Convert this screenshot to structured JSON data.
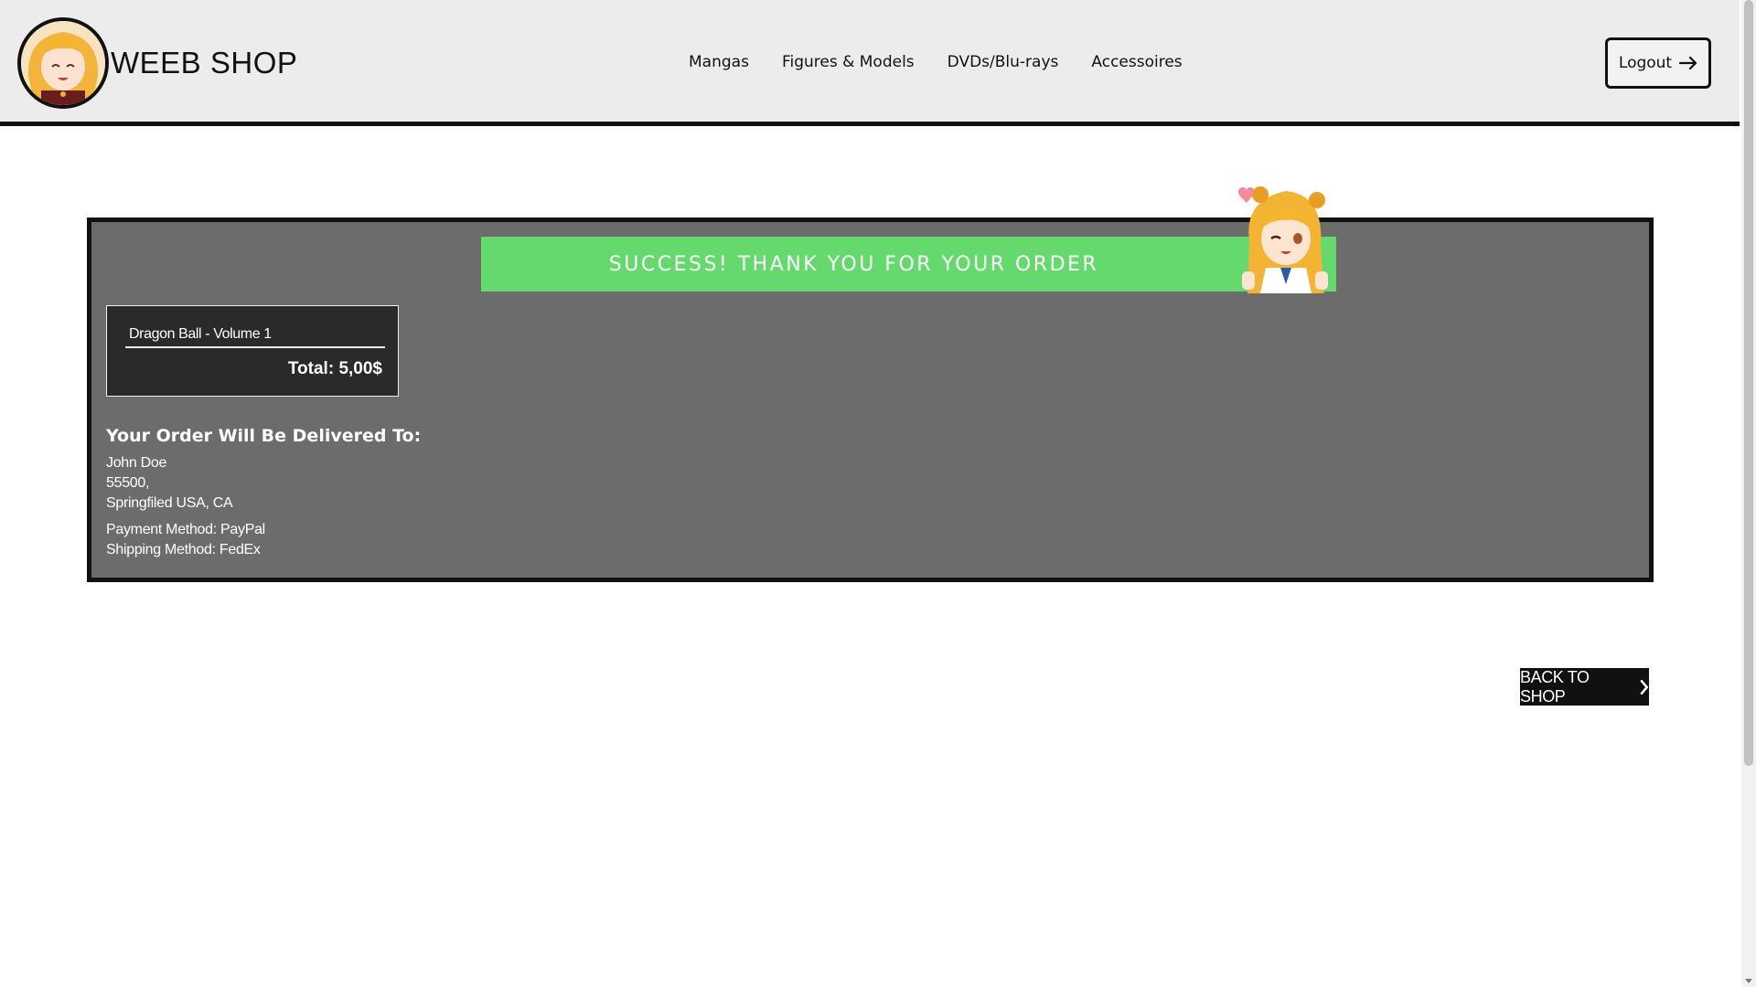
{
  "header": {
    "brand": "WEEB SHOP",
    "nav": [
      "Mangas",
      "Figures & Models",
      "DVDs/Blu-rays",
      "Accessoires"
    ],
    "logout_label": "Logout",
    "logout_icon": "arrow-right-icon",
    "logo_icon": "anime-girl-avatar"
  },
  "banner": {
    "text": "SUCCESS! THANK YOU FOR YOUR ORDER",
    "color": "#66d96e",
    "mascot_icon": "anime-girl-thumbs-up"
  },
  "order": {
    "item": "Dragon Ball - Volume 1",
    "total": "Total: 5,00$"
  },
  "delivery": {
    "heading": "Your Order Will Be Delivered To:",
    "name": "John Doe",
    "zip": "55500,",
    "city": "Springfiled USA, CA",
    "payment": "Payment Method: PayPal",
    "shipping": "Shipping Method: FedEx"
  },
  "actions": {
    "back_label": "BACK TO SHOP",
    "back_icon": "chevron-right-icon"
  },
  "colors": {
    "panel_bg": "#6c6c6c",
    "order_box_bg": "#2a2a2a",
    "header_bg": "#ececec"
  }
}
